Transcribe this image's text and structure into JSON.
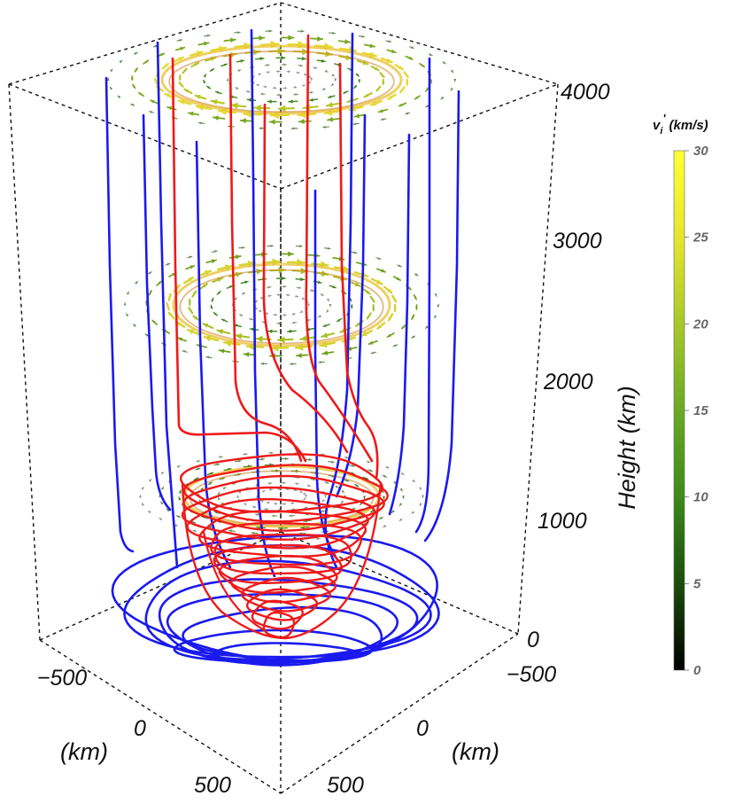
{
  "chart_data": {
    "type": "3d-streamline-plot",
    "axes": {
      "z": {
        "label": "Height (km)",
        "range": [
          0,
          4000
        ],
        "ticks": [
          "0",
          "1000",
          "2000",
          "3000",
          "4000"
        ]
      },
      "x": {
        "label": "(km)",
        "range": [
          -500,
          500
        ],
        "ticks": [
          "−500",
          "0",
          "500"
        ]
      },
      "y": {
        "label": "(km)",
        "range": [
          -500,
          500
        ],
        "ticks": [
          "−500",
          "0",
          "500"
        ]
      }
    },
    "colorbar": {
      "title_main": "v",
      "title_sub": "i",
      "title_sup": "'",
      "title_units": "(km/s)",
      "range": [
        0,
        30
      ],
      "ticks": [
        "0",
        "5",
        "10",
        "15",
        "20",
        "25",
        "30"
      ],
      "colors": [
        "#000000",
        "#1a4d0a",
        "#3c8a1a",
        "#6aaa22",
        "#a8c82a",
        "#e6e62e",
        "#ffff33"
      ]
    },
    "series": [
      {
        "name": "",
        "color": "#1a1aee"
      },
      {
        "name": "",
        "color": "#ee1a1a"
      }
    ],
    "vector_slices_height_km": [
      1000,
      2500,
      4000
    ]
  }
}
